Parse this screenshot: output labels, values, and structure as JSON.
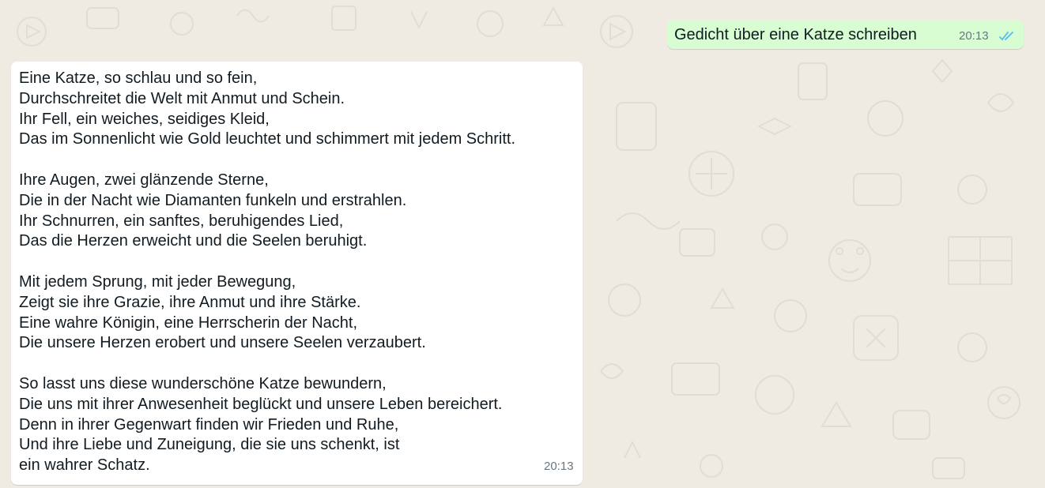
{
  "theme": {
    "chat_background": "#efeae2",
    "outgoing_bubble": "#d9fdd3",
    "incoming_bubble": "#ffffff",
    "read_tick_color": "#53bdeb",
    "meta_text_color": "#667781"
  },
  "outgoing_message": {
    "text": "Gedicht über eine Katze schreiben",
    "time": "20:13",
    "status_icon": "double-check-read-icon"
  },
  "incoming_message": {
    "stanzas": [
      {
        "lines": [
          "Eine Katze, so schlau und so fein,",
          "Durchschreitet die Welt mit Anmut und Schein.",
          "Ihr Fell, ein weiches, seidiges Kleid,",
          "Das im Sonnenlicht wie Gold leuchtet und schimmert mit jedem Schritt."
        ]
      },
      {
        "lines": [
          "Ihre Augen, zwei glänzende Sterne,",
          "Die in der Nacht wie Diamanten funkeln und erstrahlen.",
          "Ihr Schnurren, ein sanftes, beruhigendes Lied,",
          "Das die Herzen erweicht und die Seelen beruhigt."
        ]
      },
      {
        "lines": [
          "Mit jedem Sprung, mit jeder Bewegung,",
          "Zeigt sie ihre Grazie, ihre Anmut und ihre Stärke.",
          "Eine wahre Königin, eine Herrscherin der Nacht,",
          "Die unsere Herzen erobert und unsere Seelen verzaubert."
        ]
      },
      {
        "lines": [
          "So lasst uns diese wunderschöne Katze bewundern,",
          "Die uns mit ihrer Anwesenheit beglückt und unsere Leben bereichert.",
          "Denn in ihrer Gegenwart finden wir Frieden und Ruhe,",
          "Und ihre Liebe und Zuneigung, die sie uns schenkt, ist",
          "ein wahrer Schatz."
        ]
      }
    ],
    "time": "20:13"
  }
}
